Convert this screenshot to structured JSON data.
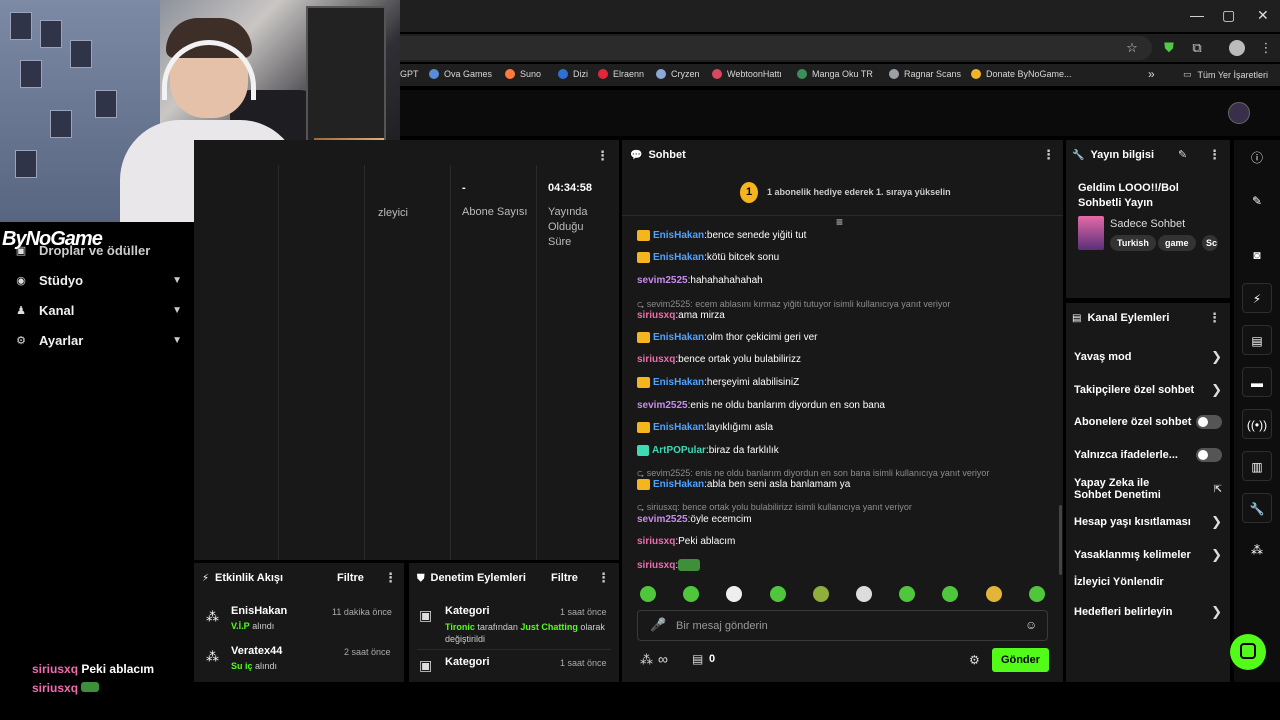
{
  "bookmarks": [
    {
      "label": "GPT",
      "color": "#888888"
    },
    {
      "label": "Ova Games",
      "color": "#5a8bd6"
    },
    {
      "label": "Suno",
      "color": "#ff7a3c"
    },
    {
      "label": "Dizi",
      "color": "#2f6fd6"
    },
    {
      "label": "Elraenn",
      "color": "#e0283a"
    },
    {
      "label": "Cryzen",
      "color": "#8aa9d9"
    },
    {
      "label": "WebtoonHattı",
      "color": "#d9485f"
    },
    {
      "label": "Manga Oku TR",
      "color": "#3a8f5a"
    },
    {
      "label": "Ragnar Scans",
      "color": "#9aa0a6"
    },
    {
      "label": "Donate ByNoGame...",
      "color": "#f0b429"
    }
  ],
  "bookmarks_all": "Tüm Yer İşaretleri",
  "brand": "ByNoGame",
  "sidebar": {
    "cut_item": "Droplar ve ödüller",
    "items": [
      {
        "label": "Stüdyo"
      },
      {
        "label": "Kanal"
      },
      {
        "label": "Ayarlar"
      }
    ]
  },
  "stats": {
    "columns": [
      {
        "value": "",
        "label": "İzleyici"
      },
      {
        "value": "-",
        "label": "Abone Sayısı"
      },
      {
        "value": "04:34:58",
        "label": "Yayında Olduğu Süre"
      }
    ]
  },
  "activity": {
    "title": "Etkinlik Akışı",
    "filter": "Filtre",
    "items": [
      {
        "name": "EnisHakan",
        "badge": "V.İ.P",
        "action": "alındı",
        "time": "11 dakika önce"
      },
      {
        "name": "Veratex44",
        "badge": "Su iç",
        "action": "alındı",
        "time": "2 saat önce"
      }
    ]
  },
  "moderation": {
    "title": "Denetim Eylemleri",
    "filter": "Filtre",
    "items": [
      {
        "name": "Kategori",
        "by": "Tironic",
        "mid": "tarafından",
        "value": "Just Chatting",
        "tail": "olarak değiştirildi",
        "time": "1 saat önce"
      },
      {
        "name": "Kategori",
        "by": "",
        "mid": "",
        "value": "",
        "tail": "",
        "time": "1 saat önce"
      }
    ]
  },
  "chat": {
    "title": "Sohbet",
    "sub_goal_number": "1",
    "sub_goal_text": "1 abonelik hediye ederek 1. sıraya yükselin",
    "messages": [
      {
        "user": "EnisHakan",
        "color": "#4fa3ff",
        "crown": true,
        "text": "bence senede yiğiti tut"
      },
      {
        "user": "EnisHakan",
        "color": "#4fa3ff",
        "crown": true,
        "text": "kötü bitcek sonu"
      },
      {
        "user": "sevim2525",
        "color": "#c88cf0",
        "crown": false,
        "text": "hahahahahahah"
      },
      {
        "reply": "sevim2525: ecem ablasını kırmaz yiğiti tutuyor isimli kullanıcıya yanıt veriyor"
      },
      {
        "user": "siriusxq",
        "color": "#f06cae",
        "crown": false,
        "text": "ama mirza"
      },
      {
        "user": "EnisHakan",
        "color": "#4fa3ff",
        "crown": true,
        "text": "olm thor çekicimi geri ver"
      },
      {
        "user": "siriusxq",
        "color": "#f06cae",
        "crown": false,
        "text": "bence ortak yolu bulabilirizz"
      },
      {
        "user": "EnisHakan",
        "color": "#4fa3ff",
        "crown": true,
        "text": "herşeyimi alabilisiniZ"
      },
      {
        "user": "sevim2525",
        "color": "#c88cf0",
        "crown": false,
        "text": "enis ne oldu banlarım diyordun en son bana"
      },
      {
        "user": "EnisHakan",
        "color": "#4fa3ff",
        "crown": true,
        "text": "layıklığımı asla"
      },
      {
        "user": "ArtPOPular",
        "color": "#3fd9b4",
        "crown": false,
        "text": "biraz da farklılık"
      },
      {
        "reply": "sevim2525: enis ne oldu banlarım diyordun en son bana isimli kullanıcıya yanıt veriyor"
      },
      {
        "user": "EnisHakan",
        "color": "#4fa3ff",
        "crown": true,
        "text": "abla ben seni asla banlamam ya"
      },
      {
        "reply": "siriusxq: bence ortak yolu bulabilirizz isimli kullanıcıya yanıt veriyor"
      },
      {
        "user": "sevim2525",
        "color": "#c88cf0",
        "crown": false,
        "text": "öyle ecemcim"
      },
      {
        "user": "siriusxq",
        "color": "#f06cae",
        "crown": false,
        "text": "Peki ablacım"
      },
      {
        "user": "siriusxq",
        "color": "#f06cae",
        "crown": false,
        "text": ""
      }
    ],
    "input_placeholder": "Bir mesaj gönderin",
    "points_symbol": "∞",
    "gift_count": "0",
    "send_label": "Gönder"
  },
  "stream_info": {
    "title": "Yayın bilgisi",
    "stream_title": "Geldim LOOO!!/Bol Sohbetli Yayın",
    "category": "Sadece Sohbet",
    "tags": [
      "Turkish",
      "game",
      "Sc"
    ]
  },
  "channel_actions": {
    "title": "Kanal Eylemleri",
    "items": [
      {
        "label": "Yavaş mod",
        "control": "chevron"
      },
      {
        "label": "Takipçilere özel sohbet",
        "control": "chevron"
      },
      {
        "label": "Abonelere özel sohbet",
        "control": "toggle"
      },
      {
        "label": "Yalnızca ifadelerle...",
        "control": "toggle"
      },
      {
        "label": "Yapay Zeka ile Sohbet Denetimi",
        "control": "external"
      },
      {
        "label": "Hesap yaşı kısıtlaması",
        "control": "chevron"
      },
      {
        "label": "Yasaklanmış kelimeler",
        "control": "chevron"
      },
      {
        "label": "İzleyici Yönlendir",
        "control": "none"
      },
      {
        "label": "Hedefleri belirleyin",
        "control": "chevron"
      }
    ]
  },
  "overlay_chat": [
    {
      "user": "siriusxq",
      "text": "Peki ablacım"
    },
    {
      "user": "siriusxq",
      "text": ""
    }
  ],
  "colors": {
    "accent": "#53fc18",
    "panel": "#181818",
    "background": "#000000"
  }
}
